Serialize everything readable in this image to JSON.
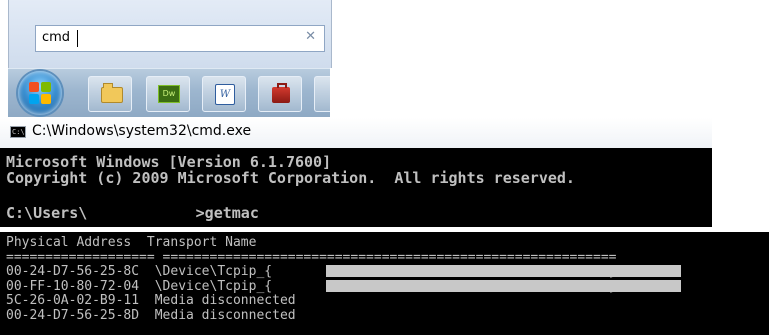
{
  "search": {
    "value": "cmd",
    "clear_icon": "✕"
  },
  "taskbar": {
    "items": [
      {
        "name": "start-orb-icon"
      },
      {
        "name": "folder-icon"
      },
      {
        "name": "dreamweaver-icon",
        "label": "Dw"
      },
      {
        "name": "word-icon",
        "label": "W"
      },
      {
        "name": "toolbox-icon"
      }
    ]
  },
  "window": {
    "title": "C:\\Windows\\system32\\cmd.exe",
    "icon_label": "C:\\"
  },
  "console": {
    "line1": "Microsoft Windows [Version 6.1.7600]",
    "line2": "Copyright (c) 2009 Microsoft Corporation.  All rights reserved.",
    "prompt": "C:\\Users\\            >getmac"
  },
  "getmac": {
    "header_address": "Physical Address",
    "header_transport": "Transport Name",
    "sep_address": "===================",
    "sep_transport": "==========================================================",
    "rows": [
      {
        "address": "00-24-D7-56-25-8C",
        "transport": "\\Device\\Tcpip_{                                          F}"
      },
      {
        "address": "00-FF-10-80-72-04",
        "transport": "\\Device\\Tcpip_{                                          5}"
      },
      {
        "address": "5C-26-0A-02-B9-11",
        "transport": "Media disconnected"
      },
      {
        "address": "00-24-D7-56-25-8D",
        "transport": "Media disconnected"
      }
    ]
  }
}
